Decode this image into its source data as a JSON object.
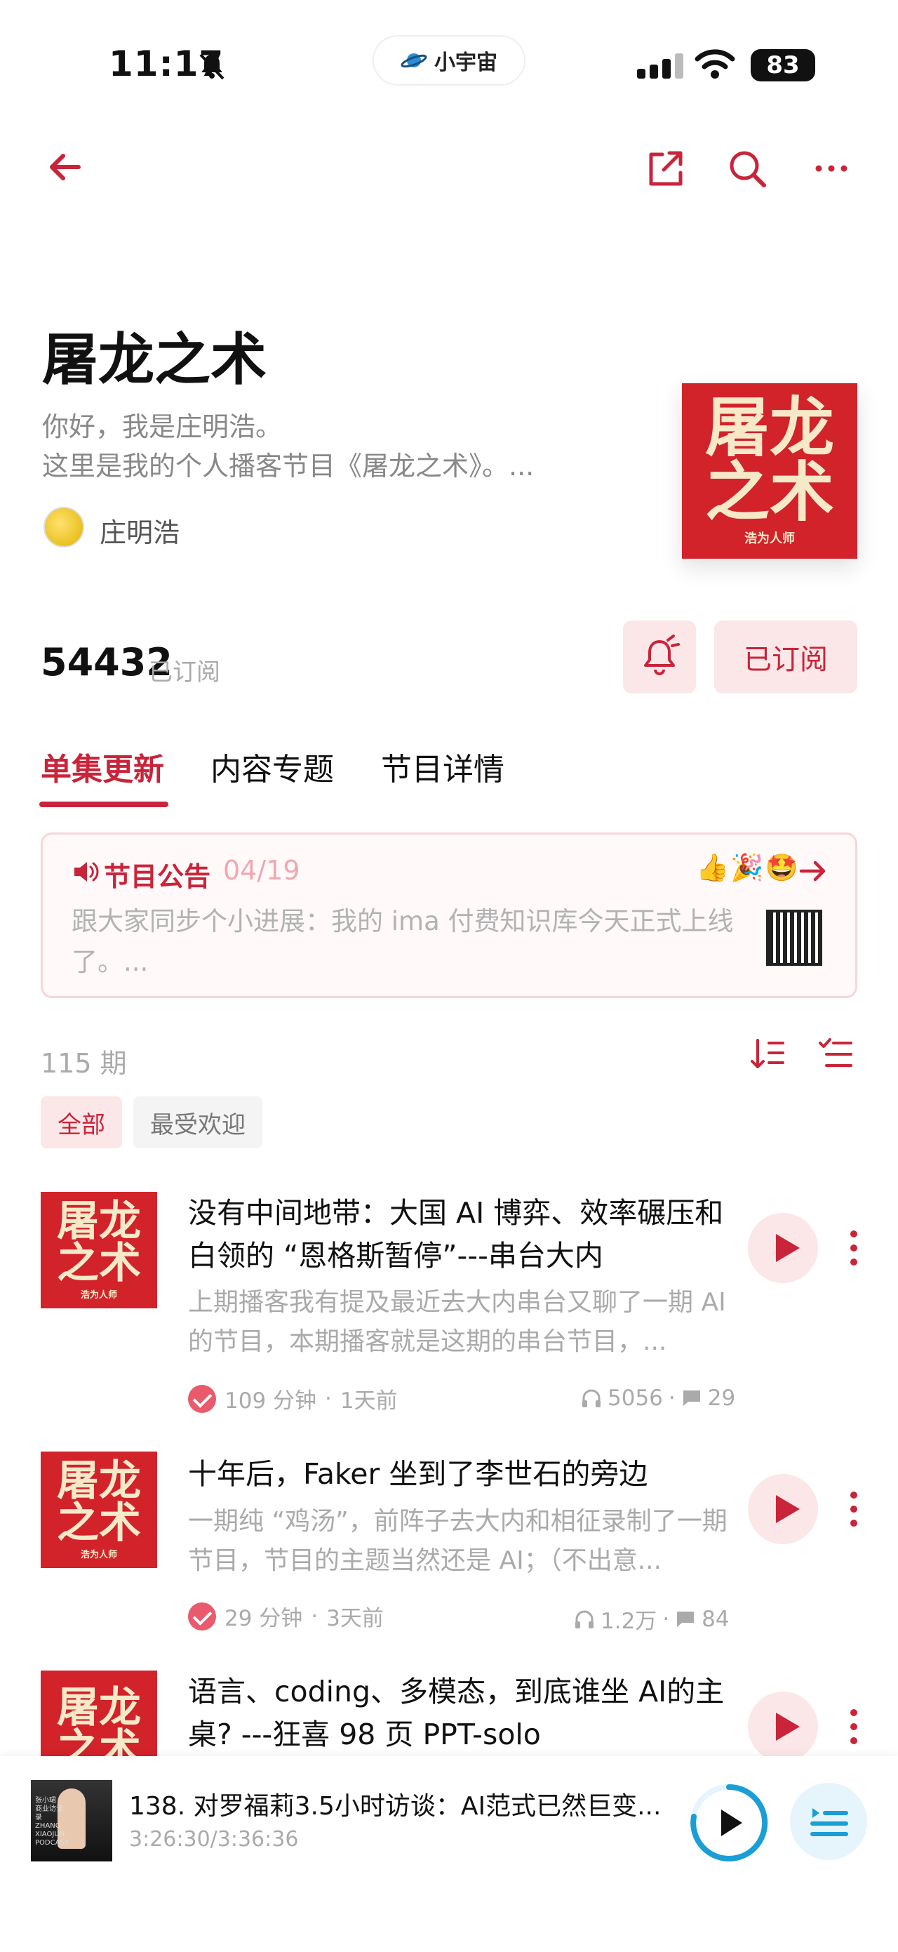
{
  "status_bar": {
    "time": "11:17",
    "app_pill": "小宇宙",
    "battery": "83"
  },
  "podcast": {
    "title": "屠龙之术",
    "description_line1": "你好，我是庄明浩。",
    "description_line2": "这里是我的个人播客节目《屠龙之术》。...",
    "host": "庄明浩",
    "cover_text": "屠龙之术",
    "cover_sub": "浩为人师",
    "subscriber_count": "54432",
    "subscriber_label": "已订阅",
    "subscribed_button": "已订阅"
  },
  "tabs": [
    "单集更新",
    "内容专题",
    "节目详情"
  ],
  "announcement": {
    "label": "节目公告",
    "date": "04/19",
    "emojis": "👍🎉🤩",
    "text": "跟大家同步个小进展：我的 ima 付费知识库今天正式上线了。..."
  },
  "list": {
    "count": "115 期",
    "filters": [
      "全部",
      "最受欢迎"
    ]
  },
  "episodes": [
    {
      "title": "没有中间地带：大国 AI 博弈、效率碾压和白领的 “恩格斯暂停”---串台大内",
      "desc": "上期播客我有提及最近去大内串台又聊了一期 AI的节目，本期播客就是这期的串台节目，...",
      "duration": "109 分钟",
      "ago": "1天前",
      "plays": "5056",
      "comments": "29"
    },
    {
      "title": "十年后，Faker 坐到了李世石的旁边",
      "desc": "一期纯 “鸡汤”，前阵子去大内和相征录制了一期节目，节目的主题当然还是 AI；（不出意...",
      "duration": "29 分钟",
      "ago": "3天前",
      "plays": "1.2万",
      "comments": "84"
    },
    {
      "title": "语言、coding、多模态，到底谁坐 AI的主桌? ---狂喜 98 页 PPT-solo",
      "desc": "",
      "duration": "",
      "ago": "",
      "plays": "",
      "comments": ""
    }
  ],
  "player": {
    "title": "138. 对罗福莉3.5小时访谈：AI范式已然巨变...",
    "progress": "3:26:30/3:36:36",
    "cover_text": "张小珺 商业访谈录 ZHANG XIAOJUN PODCAST"
  },
  "colors": {
    "accent": "#c9243a",
    "cover_red": "#d2222a",
    "light_pink": "#fbe7e8"
  }
}
